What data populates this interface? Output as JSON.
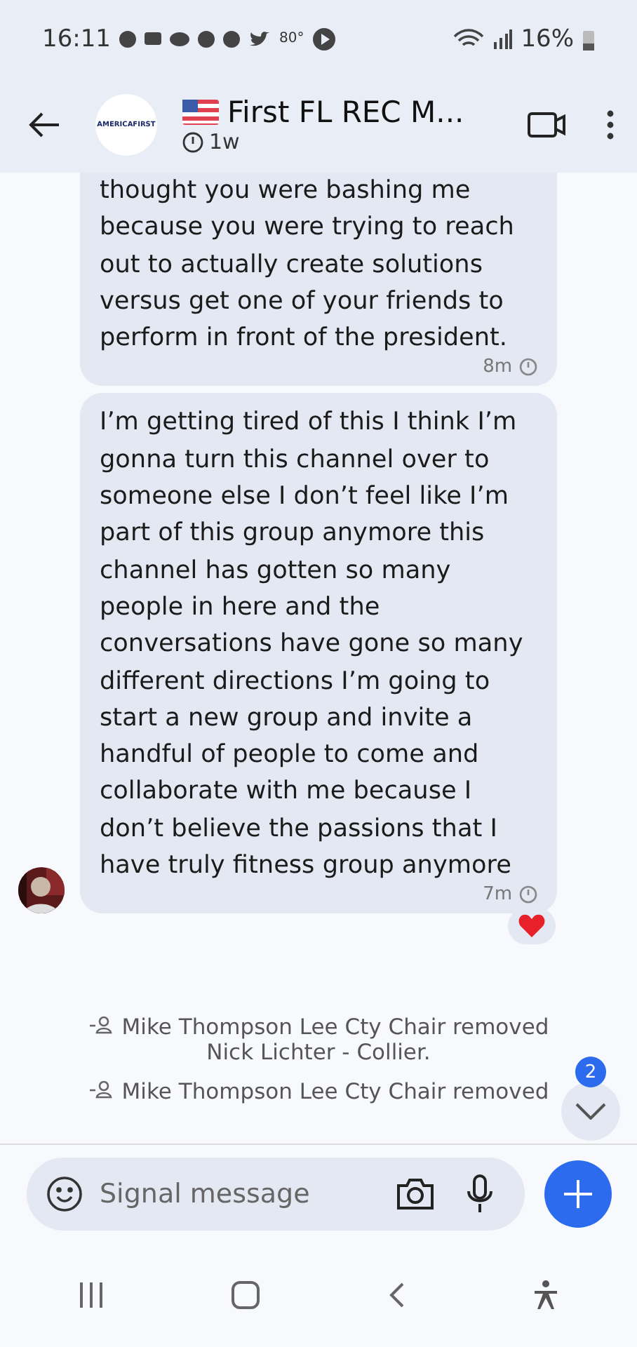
{
  "status_bar": {
    "time": "16:11",
    "temperature": "80°",
    "battery": "16%"
  },
  "header": {
    "avatar_text": "AMERICAFIRST",
    "title": "First FL REC M...",
    "subtitle": "1w"
  },
  "messages": [
    {
      "kind": "incoming",
      "text": "thought you were bashing me because you were trying to reach out to actually create solutions versus get one of your friends to perform in front of the president.",
      "time": "8m",
      "show_avatar": false,
      "reaction": false
    },
    {
      "kind": "incoming",
      "text": "I’m getting tired of this I think I’m gonna turn this channel over to someone else I don’t feel like I’m part of this group anymore this channel has gotten so many people in here and the conversations have gone so many different directions I’m going to start a new group and invite a handful of people to come and collaborate with me because I don’t believe the passions that I have truly fitness group anymore",
      "time": "7m",
      "show_avatar": true,
      "reaction": true
    },
    {
      "kind": "system",
      "text": "Mike Thompson Lee Cty Chair removed Nick Lichter - Collier."
    },
    {
      "kind": "system",
      "text": "Mike Thompson Lee Cty Chair removed"
    }
  ],
  "scroll_button": {
    "badge": "2"
  },
  "composer": {
    "placeholder": "Signal message"
  }
}
